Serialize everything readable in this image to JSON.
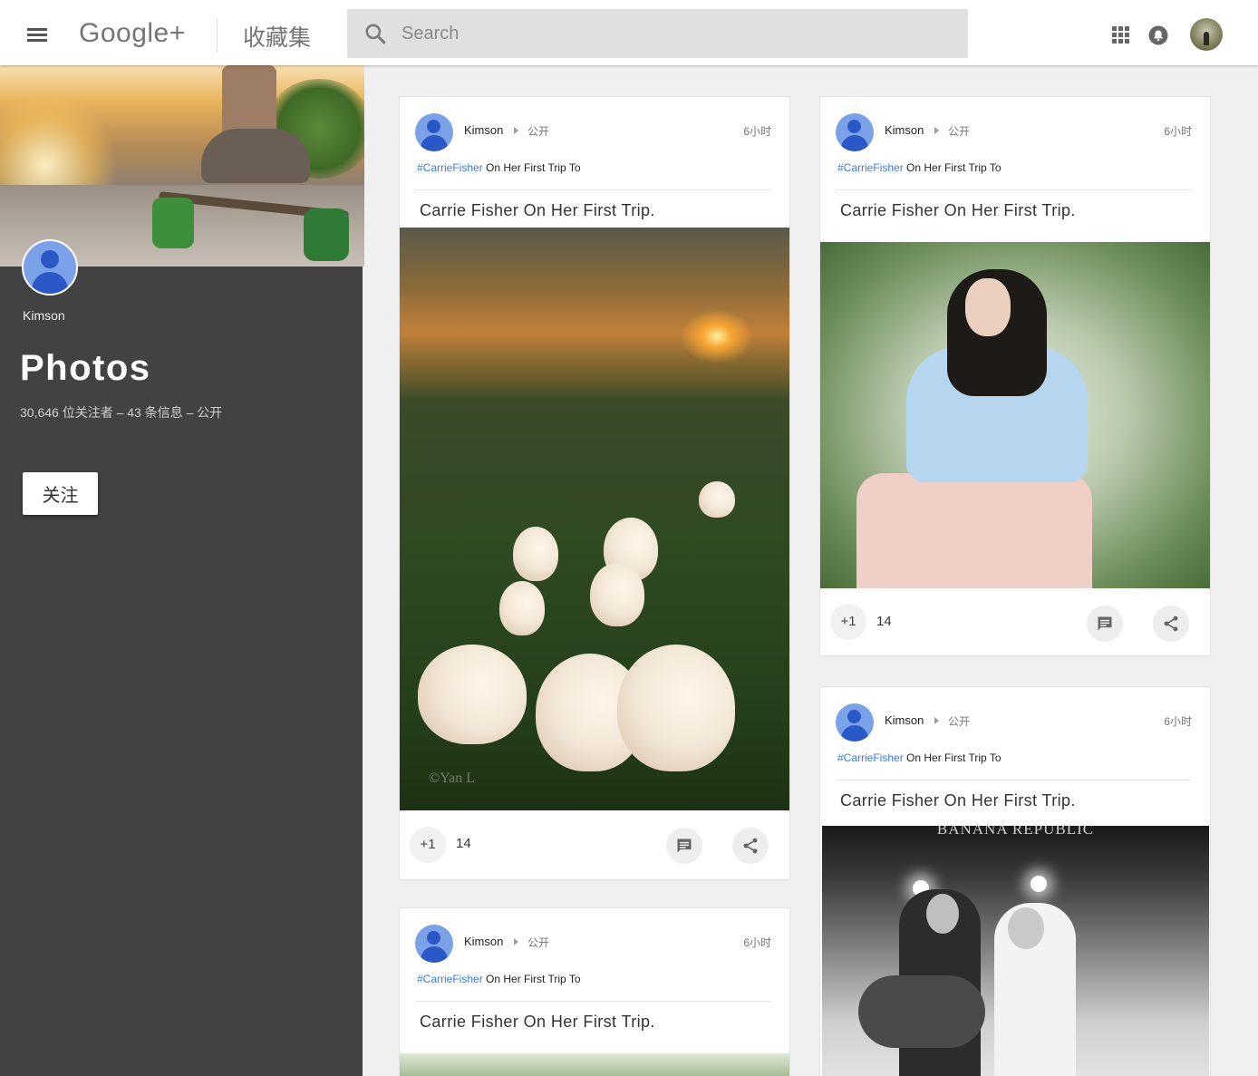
{
  "header": {
    "brand": "Google+",
    "section": "收藏集",
    "search_placeholder": "Search",
    "icons": [
      "menu-icon",
      "search-icon",
      "apps-grid-icon",
      "notifications-bell-icon",
      "user-avatar"
    ]
  },
  "collection": {
    "owner": "Kimson",
    "title": "Photos",
    "meta": "30,646 位关注者 – 43 条信息 – 公开",
    "follow_label": "关注"
  },
  "posts": [
    {
      "author": "Kimson",
      "visibility": "公开",
      "time": "6小时",
      "hashtag": "#CarrieFisher",
      "tagline_rest": " On Her First Trip To",
      "title": "Carrie Fisher On Her First Trip.",
      "plus_label": "+1",
      "plus_count": "14",
      "photo": "sunset-calla-lilies",
      "watermark": "©Yan L"
    },
    {
      "author": "Kimson",
      "visibility": "公开",
      "time": "6小时",
      "hashtag": "#CarrieFisher",
      "tagline_rest": " On Her First Trip To",
      "title": "Carrie Fisher On Her First Trip.",
      "plus_label": "+1",
      "plus_count": "14",
      "photo": "girl-blue-sweater"
    },
    {
      "author": "Kimson",
      "visibility": "公开",
      "time": "6小时",
      "hashtag": "#CarrieFisher",
      "tagline_rest": " On Her First Trip To",
      "title": "Carrie Fisher On Her First Trip.",
      "photo": "green-foliage"
    },
    {
      "author": "Kimson",
      "visibility": "公开",
      "time": "6小时",
      "hashtag": "#CarrieFisher",
      "tagline_rest": " On Her First Trip To",
      "title": "Carrie Fisher On Her First Trip.",
      "photo": "banana-republic-bw",
      "photo_sign": "BANANA REPUBLIC"
    }
  ],
  "colors": {
    "hashtag": "#3b78e7",
    "sidebar_bg": "#424242",
    "page_bg": "#f0f0f0",
    "avatar_blue": "#2b58c7"
  }
}
